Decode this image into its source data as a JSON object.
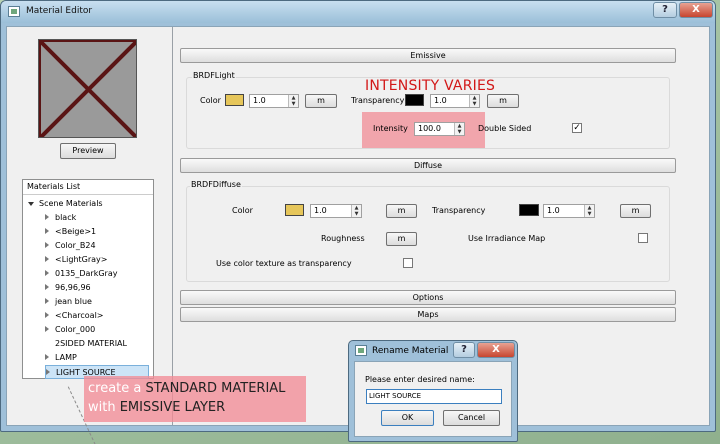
{
  "window": {
    "title": "Material Editor",
    "help_label": "?",
    "close_label": "X"
  },
  "preview_button": "Preview",
  "materials_list": {
    "header": "Materials List",
    "root": "Scene Materials",
    "items": [
      "black",
      "<Beige>1",
      "Color_B24",
      "<LightGray>",
      "0135_DarkGray",
      "96,96,96",
      "jean blue",
      "<Charcoal>",
      "Color_000",
      "2SIDED MATERIAL",
      "LAMP",
      "LIGHT SOURCE"
    ],
    "selected": "LIGHT SOURCE"
  },
  "emissive": {
    "section_label": "Emissive",
    "group_label": "BRDFLight",
    "color_label": "Color",
    "color_value": "1.0",
    "color_swatch": "#e6c65a",
    "map_button": "m",
    "transparency_label": "Transparency",
    "transparency_value": "1.0",
    "transparency_swatch": "#000000",
    "intensity_label": "Intensity",
    "intensity_value": "100.0",
    "double_sided_label": "Double Sided",
    "double_sided_checked": "✓"
  },
  "diffuse": {
    "section_label": "Diffuse",
    "group_label": "BRDFDiffuse",
    "color_label": "Color",
    "color_value": "1.0",
    "color_swatch": "#e6c65a",
    "map_button": "m",
    "transparency_label": "Transparency",
    "transparency_value": "1.0",
    "transparency_swatch": "#000000",
    "roughness_label": "Roughness",
    "irradiance_label": "Use Irradiance Map",
    "color_texture_label": "Use color texture as transparency"
  },
  "options_label": "Options",
  "maps_label": "Maps",
  "annotation_intensity": "INTENSITY VARIES",
  "callout": {
    "line1_a": "create a ",
    "line1_b": "STANDARD MATERIAL",
    "line2_a": "with ",
    "line2_b": "EMISSIVE LAYER"
  },
  "rename_dialog": {
    "title": "Rename Material",
    "prompt": "Please enter desired name:",
    "input_value": "LIGHT SOURCE",
    "ok_label": "OK",
    "cancel_label": "Cancel",
    "help_label": "?",
    "close_label": "X"
  }
}
